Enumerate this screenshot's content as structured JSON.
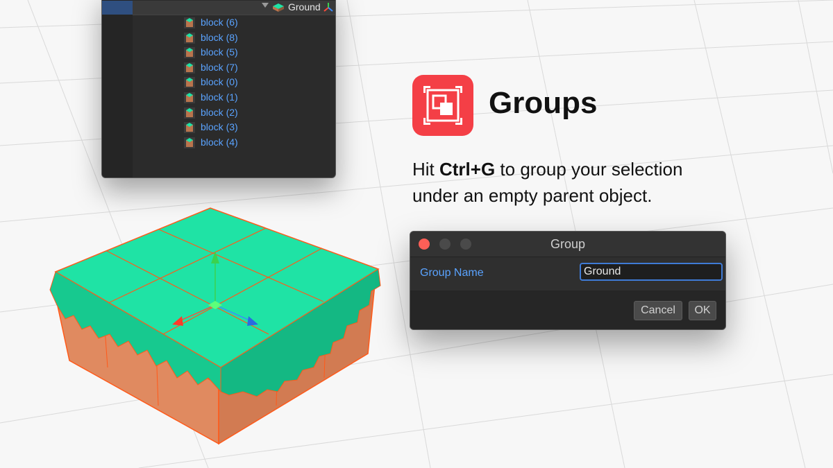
{
  "hierarchy": {
    "root_label": "Ground",
    "items": [
      {
        "label": "block (6)"
      },
      {
        "label": "block (8)"
      },
      {
        "label": "block (5)"
      },
      {
        "label": "block (7)"
      },
      {
        "label": "block (0)"
      },
      {
        "label": "block (1)"
      },
      {
        "label": "block (2)"
      },
      {
        "label": "block (3)"
      },
      {
        "label": "block (4)"
      }
    ]
  },
  "feature": {
    "title": "Groups",
    "desc_prefix": "Hit ",
    "shortcut": "Ctrl+G",
    "desc_suffix": " to group your selection under an empty parent object."
  },
  "dialog": {
    "title": "Group",
    "field_label": "Group Name",
    "field_value": "Ground",
    "cancel_label": "Cancel",
    "ok_label": "OK"
  },
  "colors": {
    "accent_red": "#f43f46",
    "link_blue": "#5aa3ff",
    "grass": "#1fe3a5",
    "dirt": "#e08a60",
    "selection_orange": "#ff5a1a"
  },
  "icons": [
    "expand-arrow-icon",
    "prefab-cube-icon",
    "axes-icon",
    "add-icon",
    "group-icon",
    "move-gizmo-icon"
  ]
}
